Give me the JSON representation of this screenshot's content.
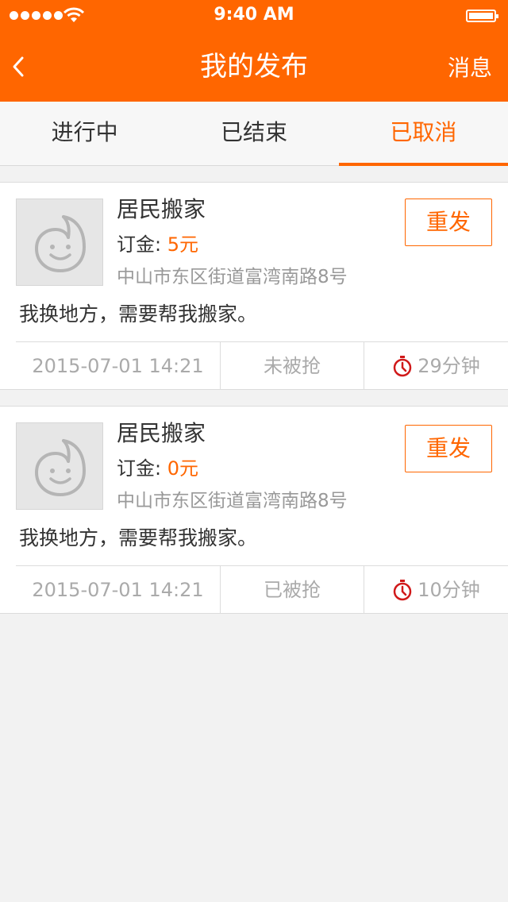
{
  "status_bar": {
    "time": "9:40 AM"
  },
  "header": {
    "title": "我的发布",
    "right_action": "消息"
  },
  "tabs": [
    {
      "label": "进行中",
      "active": false
    },
    {
      "label": "已结束",
      "active": false
    },
    {
      "label": "已取消",
      "active": true
    }
  ],
  "orders": [
    {
      "service": "居民搬家",
      "deposit_label": "订金: ",
      "deposit_amount": "5元",
      "address": "中山市东区街道富湾南路8号",
      "description": "我换地方，需要帮我搬家。",
      "repost_label": "重发",
      "datetime": "2015-07-01  14:21",
      "status": "未被抢",
      "timer": "29分钟"
    },
    {
      "service": "居民搬家",
      "deposit_label": "订金: ",
      "deposit_amount": "0元",
      "address": "中山市东区街道富湾南路8号",
      "description": "我换地方，需要帮我搬家。",
      "repost_label": "重发",
      "datetime": "2015-07-01  14:21",
      "status": "已被抢",
      "timer": "10分钟"
    }
  ],
  "colors": {
    "accent": "#ff6600",
    "timer_icon": "#d0191a"
  }
}
